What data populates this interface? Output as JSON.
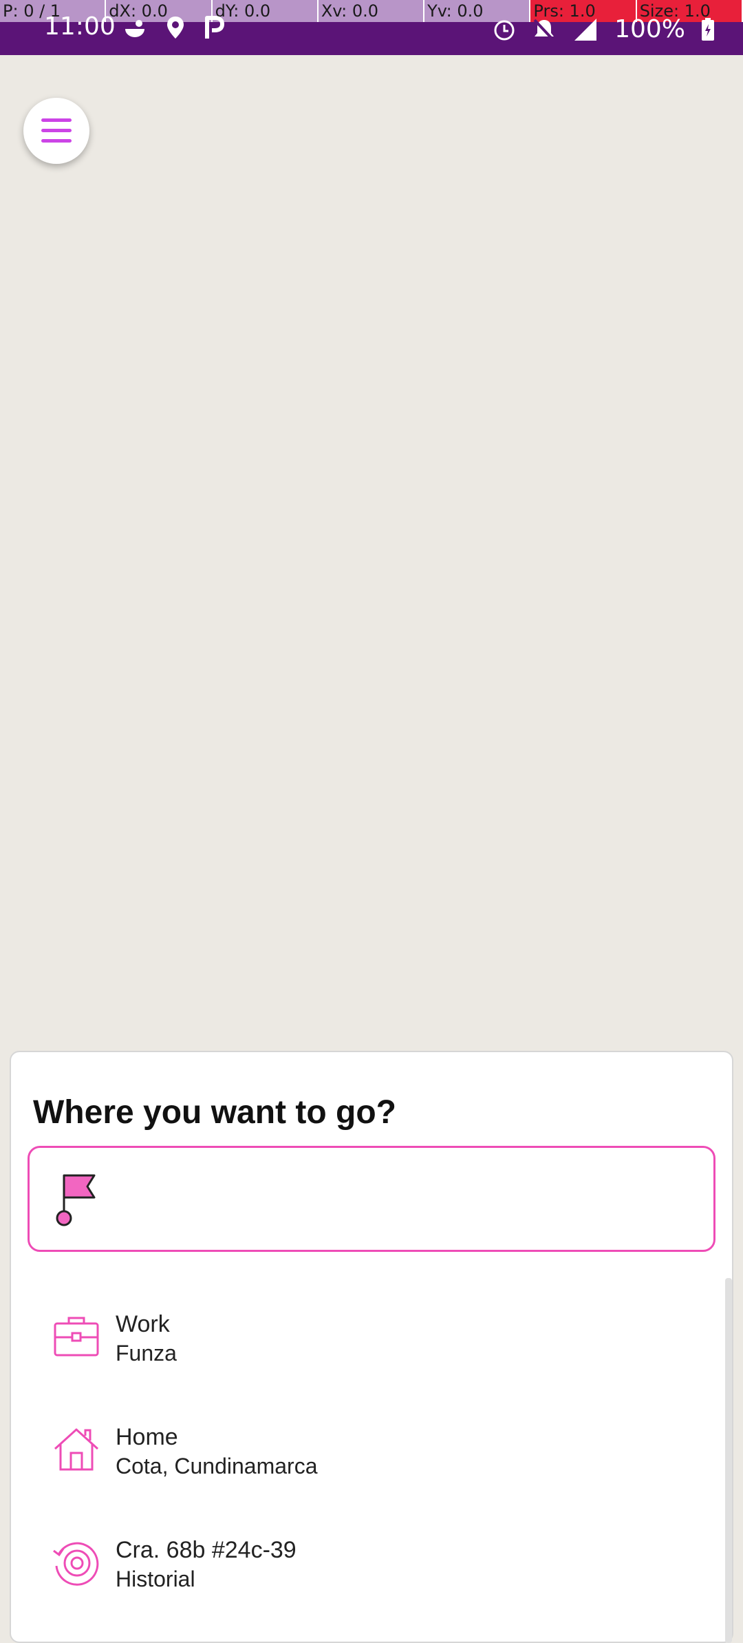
{
  "dev_overlay": [
    "P: 0 / 1",
    "dX: 0.0",
    "dY: 0.0",
    "Xv: 0.0",
    "Yv: 0.0",
    "Prs: 1.0",
    "Size: 1.0"
  ],
  "status_bar": {
    "time": "11:00",
    "battery": "100%",
    "left_icons": [
      "weather-icon",
      "location-icon",
      "parking-app-icon"
    ],
    "right_icons": [
      "alarm-icon",
      "mute-icon",
      "signal-icon",
      "battery-charging-icon"
    ]
  },
  "colors": {
    "status_bar": "#5b1477",
    "accent": "#ee4cb6",
    "menu_icon": "#cc44e6",
    "map_background": "#ece9e3"
  },
  "menu": {
    "icon": "hamburger-menu-icon"
  },
  "sheet": {
    "title": "Where you want to go?",
    "input": {
      "value": "",
      "placeholder": "",
      "icon": "flag-pin-icon"
    },
    "places": [
      {
        "name": "Work",
        "detail": "Funza",
        "icon": "briefcase-icon"
      },
      {
        "name": "Home",
        "detail": "Cota, Cundinamarca",
        "icon": "home-icon"
      },
      {
        "name": "Cra. 68b #24c-39",
        "detail": "Historial",
        "icon": "history-icon"
      }
    ]
  }
}
